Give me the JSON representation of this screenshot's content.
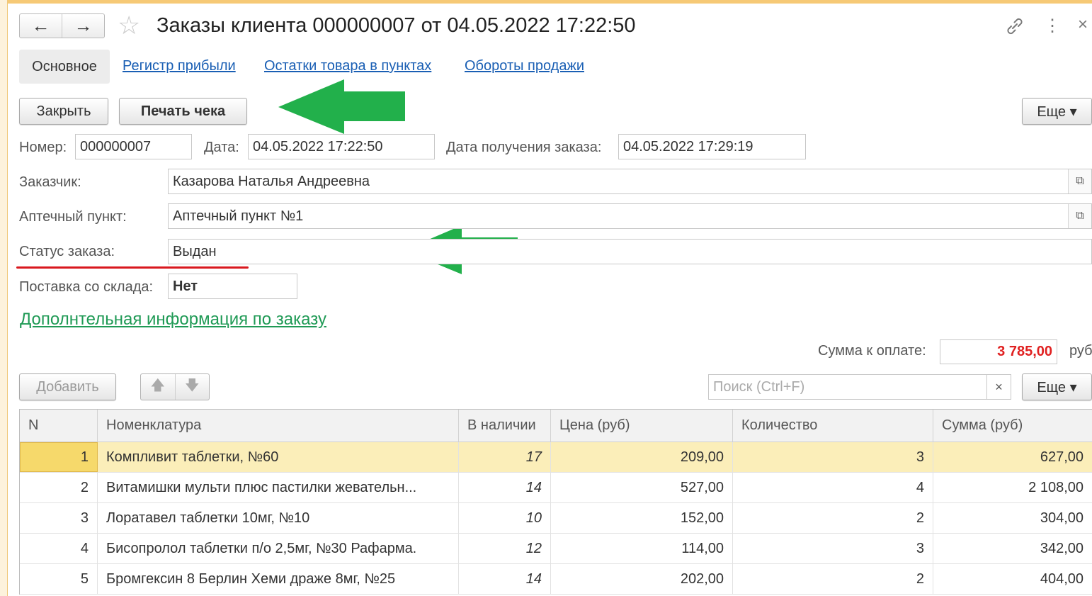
{
  "header": {
    "title": "Заказы клиента 000000007 от 04.05.2022 17:22:50",
    "back_icon": "←",
    "forward_icon": "→",
    "star_icon": "☆",
    "link_icon": "🔗",
    "more_icon": "⋮",
    "close_icon": "×"
  },
  "tabs": [
    {
      "label": "Основное"
    },
    {
      "label": "Регистр прибыли"
    },
    {
      "label": "Остатки товара в пунктах"
    },
    {
      "label": "Обороты продажи"
    }
  ],
  "toolbar": {
    "close_label": "Закрыть",
    "print_label": "Печать чека",
    "more_label": "Еще ▾"
  },
  "form": {
    "number_label": "Номер:",
    "number_value": "000000007",
    "date_label": "Дата:",
    "date_value": "04.05.2022 17:22:50",
    "receive_date_label": "Дата получения заказа:",
    "receive_date_value": "04.05.2022 17:29:19",
    "customer_label": "Заказчик:",
    "customer_value": "Казарова Наталья Андреевна",
    "pharmacy_label": "Аптечный пункт:",
    "pharmacy_value": "Аптечный пункт №1",
    "status_label": "Статус заказа:",
    "status_value": "Выдан",
    "warehouse_label": "Поставка со склада:",
    "warehouse_value": "Нет",
    "open_icon": "⧉"
  },
  "extra_link": "Дополнтельная информация по заказу",
  "summary": {
    "label": "Сумма к оплате:",
    "value": "3 785,00",
    "currency": "руб"
  },
  "table_toolbar": {
    "add_label": "Добавить",
    "up_icon": "🡅",
    "down_icon": "🡇",
    "search_placeholder": "Поиск (Ctrl+F)",
    "clear_icon": "×",
    "more_label": "Еще ▾"
  },
  "table": {
    "columns": [
      "N",
      "Номенклатура",
      "В наличии",
      "Цена (руб)",
      "Количество",
      "Сумма (руб)"
    ],
    "rows": [
      {
        "n": "1",
        "name": "Компливит таблетки, №60",
        "avail": "17",
        "price": "209,00",
        "qty": "3",
        "sum": "627,00"
      },
      {
        "n": "2",
        "name": "Витамишки мульти плюс пастилки жевательн...",
        "avail": "14",
        "price": "527,00",
        "qty": "4",
        "sum": "2 108,00"
      },
      {
        "n": "3",
        "name": "Лоратавел таблетки 10мг, №10",
        "avail": "10",
        "price": "152,00",
        "qty": "2",
        "sum": "304,00"
      },
      {
        "n": "4",
        "name": "Бисопролол таблетки п/о 2,5мг, №30 Рафарма.",
        "avail": "12",
        "price": "114,00",
        "qty": "3",
        "sum": "342,00"
      },
      {
        "n": "5",
        "name": "Бромгексин 8 Берлин Хеми драже 8мг, №25",
        "avail": "14",
        "price": "202,00",
        "qty": "2",
        "sum": "404,00"
      }
    ]
  },
  "colors": {
    "annotation_arrow": "#22b04b",
    "underline_mark": "#d9181e",
    "total_value": "#e02020",
    "link": "#1a5fb4",
    "green_link": "#1f9a55"
  }
}
